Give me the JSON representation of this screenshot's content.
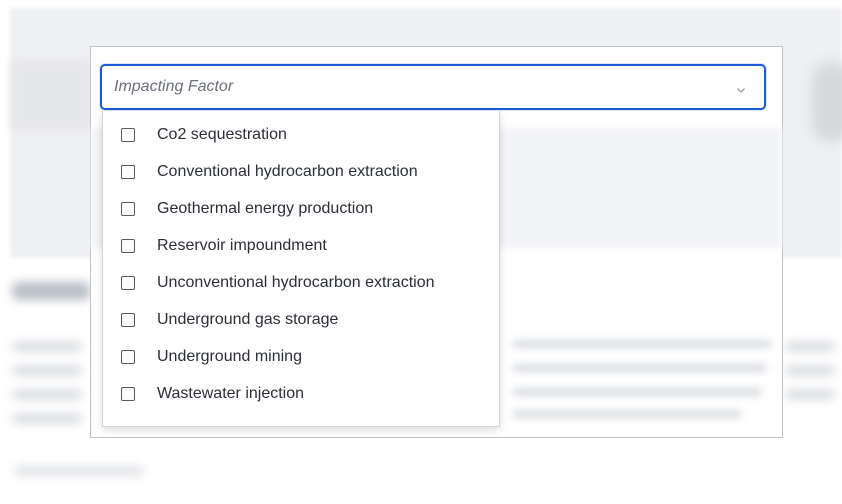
{
  "filter": {
    "placeholder": "Impacting Factor",
    "chevron_icon": "chevron-down-icon",
    "accent_color": "#1a5bd6"
  },
  "options": [
    {
      "label": "Co2 sequestration",
      "checked": false
    },
    {
      "label": "Conventional hydrocarbon extraction",
      "checked": false
    },
    {
      "label": "Geothermal energy production",
      "checked": false
    },
    {
      "label": "Reservoir impoundment",
      "checked": false
    },
    {
      "label": "Unconventional hydrocarbon extraction",
      "checked": false
    },
    {
      "label": "Underground gas storage",
      "checked": false
    },
    {
      "label": "Underground mining",
      "checked": false
    },
    {
      "label": "Wastewater injection",
      "checked": false
    }
  ]
}
